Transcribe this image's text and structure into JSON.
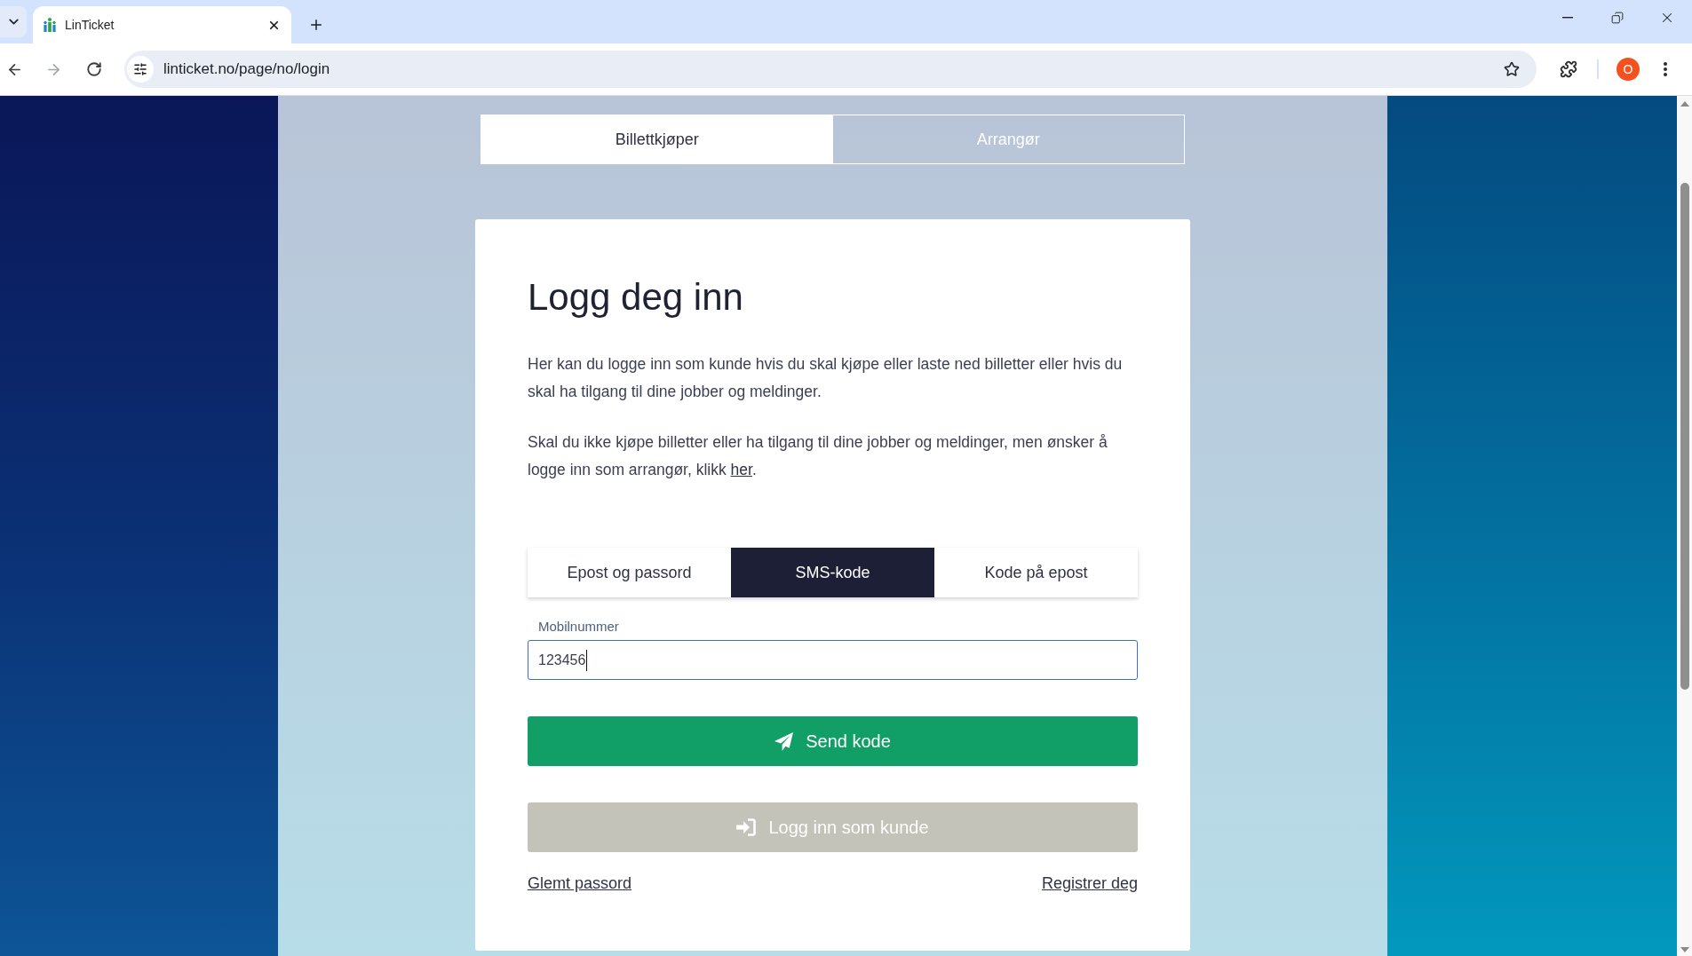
{
  "browser": {
    "tab_title": "LinTicket",
    "back_disabled": false,
    "forward_disabled": true,
    "address": "linticket.no/page/no/login",
    "profile_initial": "O"
  },
  "role_tabs": [
    {
      "label": "Billettkjøper",
      "selected": true
    },
    {
      "label": "Arrangør",
      "selected": false
    }
  ],
  "login": {
    "title": "Logg deg inn",
    "intro": "Her kan du logge inn som kunde hvis du skal kjøpe eller laste ned billetter eller hvis du skal ha tilgang til dine jobber og meldinger.",
    "organizer_note": {
      "text": "Skal du ikke kjøpe billetter eller ha tilgang til dine jobber og meldinger, men ønsker å logge inn som arrangør, klikk ",
      "link": "her",
      "suffix": "."
    },
    "method_tabs": [
      {
        "label": "Epost og passord",
        "selected": false
      },
      {
        "label": "SMS-kode",
        "selected": true
      },
      {
        "label": "Kode på epost",
        "selected": false
      }
    ],
    "phone_field": {
      "label": "Mobilnummer",
      "value": "123456",
      "focused": true
    },
    "send_button": {
      "label": "Send kode"
    },
    "login_button": {
      "label": "Logg inn som kunde",
      "disabled": true
    },
    "forgot_link": "Glemt passord",
    "register_link": "Registrer deg"
  }
}
